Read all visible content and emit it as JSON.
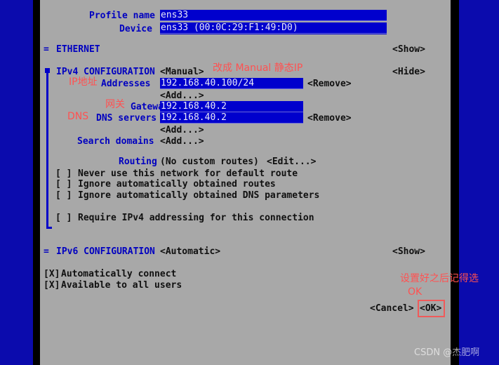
{
  "app": {
    "name": "nmtui-edit-connection",
    "background_color": "#0b0bad",
    "dialog_color": "#a8a8a8",
    "field_color": "#0000cd",
    "label_color": "#0000c0",
    "annotation_color": "#ff5151"
  },
  "fields": {
    "profile_name_label": "Profile name",
    "profile_name_value": "ens33",
    "device_label": "Device",
    "device_value": "ens33 (00:0C:29:F1:49:D0)"
  },
  "ethernet_section": {
    "marker": "=",
    "title": "ETHERNET",
    "toggle": "<Show>"
  },
  "ipv4_section": {
    "marker": "■",
    "title": "IPv4 CONFIGURATION",
    "mode": "<Manual>",
    "toggle": "<Hide>",
    "annotation": "改成 Manual 静态IP",
    "addresses": {
      "label": "Addresses",
      "annotation": "IP地址",
      "value": "192.168.40.100/24",
      "remove": "<Remove>",
      "add": "<Add...>"
    },
    "gateway": {
      "label": "Gateway",
      "annotation": "网关",
      "value": "192.168.40.2"
    },
    "dns": {
      "label": "DNS servers",
      "annotation": "DNS",
      "value": "192.168.40.2",
      "remove": "<Remove>",
      "add": "<Add...>"
    },
    "search_domains": {
      "label": "Search domains",
      "add": "<Add...>"
    },
    "routing": {
      "label": "Routing",
      "value": "(No custom routes)",
      "edit": "<Edit...>"
    },
    "checkboxes": [
      {
        "state": "[ ]",
        "label": "Never use this network for default route"
      },
      {
        "state": "[ ]",
        "label": "Ignore automatically obtained routes"
      },
      {
        "state": "[ ]",
        "label": "Ignore automatically obtained DNS parameters"
      },
      {
        "state": "[ ]",
        "label": "Require IPv4 addressing for this connection"
      }
    ]
  },
  "ipv6_section": {
    "marker": "=",
    "title": "IPv6 CONFIGURATION",
    "mode": "<Automatic>",
    "toggle": "<Show>"
  },
  "global_options": [
    {
      "state": "[X]",
      "label": "Automatically connect"
    },
    {
      "state": "[X]",
      "label": "Available to all users"
    }
  ],
  "buttons": {
    "cancel": "<Cancel>",
    "ok": "<OK>",
    "ok_annotation_line1": "设置好之后记得选",
    "ok_annotation_line2": "OK"
  },
  "watermark": "CSDN @杰肥啊"
}
